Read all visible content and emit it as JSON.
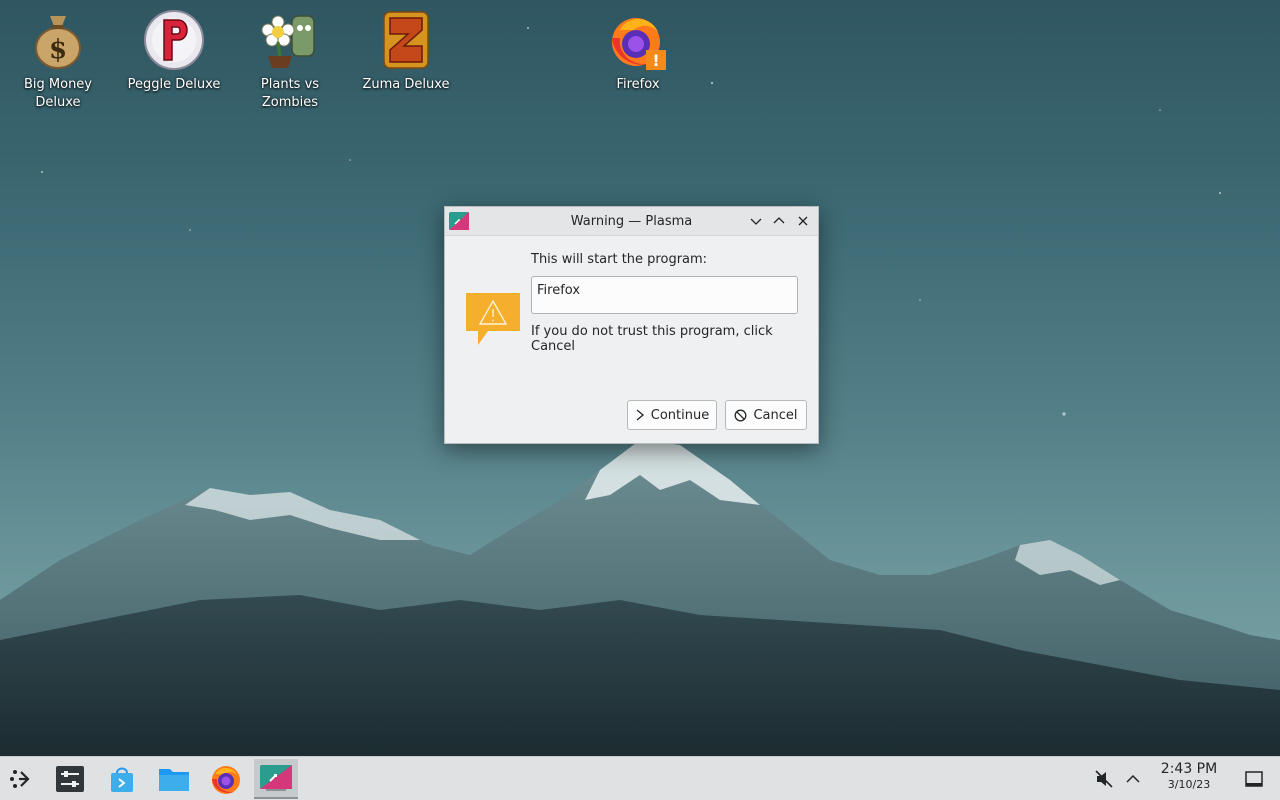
{
  "desktop": {
    "icons": [
      {
        "label": "Big Money\nDeluxe",
        "icon": "money-bag-icon"
      },
      {
        "label": "Peggle Deluxe",
        "icon": "peggle-icon"
      },
      {
        "label": "Plants vs\nZombies",
        "icon": "plants-vs-zombies-icon"
      },
      {
        "label": "Zuma Deluxe",
        "icon": "zuma-icon"
      },
      {
        "label": "Firefox",
        "icon": "firefox-warning-icon"
      }
    ]
  },
  "dialog": {
    "title": "Warning — Plasma",
    "lead": "This will start the program:",
    "program": "Firefox",
    "hint": "If you do not trust this program, click Cancel",
    "continue_label": "Continue",
    "cancel_label": "Cancel"
  },
  "taskbar": {
    "items": [
      "application-launcher-icon",
      "settings-sliders-icon",
      "discover-store-icon",
      "folder-icon",
      "firefox-icon",
      "plasma-warning-task-icon"
    ],
    "clock_time": "2:43 PM",
    "clock_date": "3/10/23"
  },
  "colors": {
    "warning": "#f6ae2d",
    "accent": "#3daee9"
  }
}
